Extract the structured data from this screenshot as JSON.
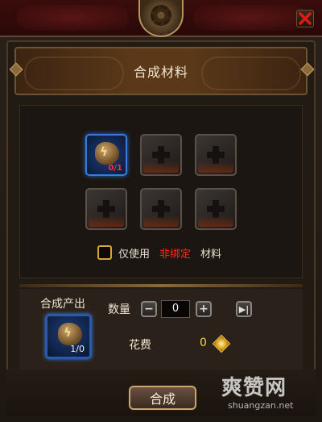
{
  "window": {
    "title": "合成材料",
    "close_icon": "close-x-icon"
  },
  "materials": {
    "slots": [
      {
        "state": "filled",
        "item_icon": "rune-stone-icon",
        "count": "0/1"
      },
      {
        "state": "empty"
      },
      {
        "state": "empty"
      },
      {
        "state": "empty"
      },
      {
        "state": "empty"
      },
      {
        "state": "empty"
      }
    ],
    "option": {
      "checked": false,
      "prefix": "仅使用",
      "highlight": "非绑定",
      "suffix": "材料",
      "highlight_color": "#ff2a1a"
    }
  },
  "output": {
    "label": "合成产出",
    "item_icon": "rune-stone-icon",
    "count": "1/0"
  },
  "quantity": {
    "label": "数量",
    "value": "0",
    "minus_icon": "minus-icon",
    "plus_icon": "plus-icon",
    "max_icon": "max-icon"
  },
  "cost": {
    "label": "花费",
    "value": "0",
    "currency_icon": "gold-coin-icon",
    "color": "#f6d34a"
  },
  "actions": {
    "craft_label": "合成"
  },
  "watermark": {
    "title": "爽赞网",
    "url": "shuangzan.net"
  }
}
